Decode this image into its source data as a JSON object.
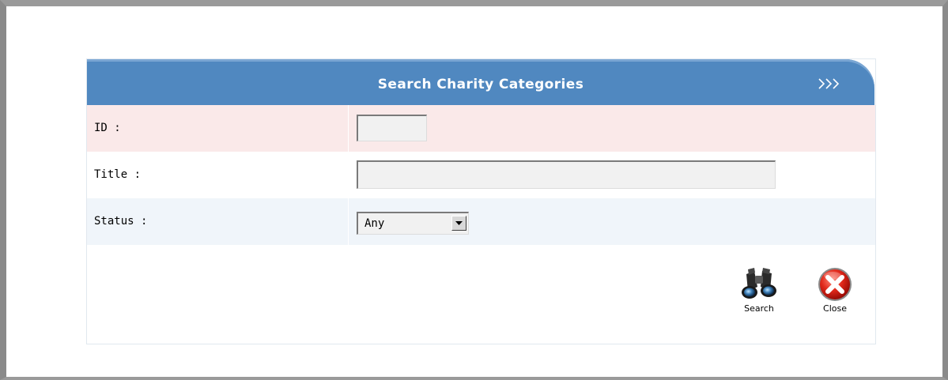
{
  "dialog": {
    "title": "Search Charity Categories",
    "header_color": "#5088c0",
    "chevron_icon": "triple-chevron-right-icon"
  },
  "form": {
    "id_label": "ID :",
    "id_value": "",
    "title_label": "Title :",
    "title_value": "",
    "status_label": "Status :",
    "status_value": "Any"
  },
  "actions": {
    "search_label": "Search",
    "search_icon": "binoculars-icon",
    "close_label": "Close",
    "close_icon": "close-x-icon"
  }
}
